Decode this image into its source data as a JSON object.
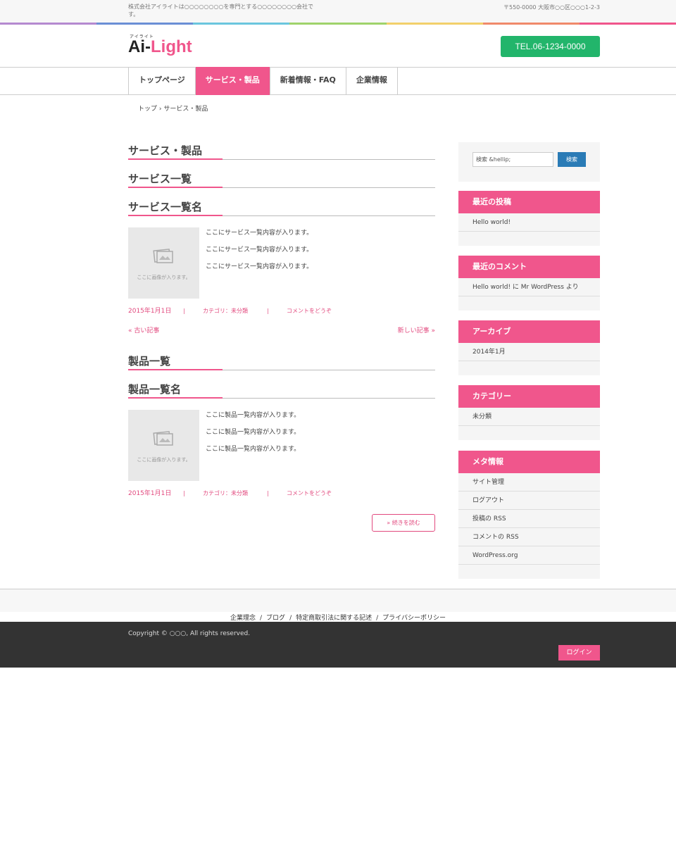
{
  "topbar": {
    "description": "株式会社アイライトは○○○○○○○○を専門とする○○○○○○○○会社です。",
    "address": "〒550-0000 大阪市○○区○○○1-2-3"
  },
  "colors": {
    "accent": "#f0568c",
    "tel_bg": "#22b56b",
    "search_button": "#2a7bb6",
    "footer_bg": "#333333",
    "rainbow": [
      "#b58ad0",
      "#6b8fd6",
      "#6bc6de",
      "#9fd36b",
      "#f2d06b",
      "#f08a6b",
      "#f0568c"
    ]
  },
  "header": {
    "logo_ruby": "アイライト",
    "logo_part1": "Ai-",
    "logo_part2": "Light",
    "tel": "TEL.06-1234-0000"
  },
  "nav": {
    "items": [
      "トップページ",
      "サービス・製品",
      "新着情報・FAQ",
      "企業情報"
    ],
    "active": "サービス・製品"
  },
  "breadcrumb": "トップ › サービス・製品",
  "main": {
    "page_title": "サービス・製品",
    "section1_title": "サービス一覧",
    "post1_title": "サービス一覧名",
    "post1_lines": [
      "ここにサービス一覧内容が入ります。",
      "ここにサービス一覧内容が入ります。",
      "ここにサービス一覧内容が入ります。"
    ],
    "thumb_caption": "ここに画像が入ります。",
    "post1_date": "2015年1月1日",
    "post1_category": "カテゴリ：未分類",
    "post1_comment": "コメントをどうぞ",
    "meta_separator": "|",
    "pager_older": "« 古い記事",
    "pager_newer": "新しい記事 »",
    "section2_title": "製品一覧",
    "post2_title": "製品一覧名",
    "post2_lines": [
      "ここに製品一覧内容が入ります。",
      "ここに製品一覧内容が入ります。",
      "ここに製品一覧内容が入ります。"
    ],
    "post2_date": "2015年1月1日",
    "post2_category": "カテゴリ：未分類",
    "post2_comment": "コメントをどうぞ",
    "read_more": "» 続きを読む"
  },
  "sidebar": {
    "search_placeholder": "検索 &hellip;",
    "search_button": "検索",
    "recent_posts": {
      "title": "最近の投稿",
      "items": [
        "Hello world!"
      ]
    },
    "recent_comments": {
      "title": "最近のコメント",
      "items": [
        "Hello world! に Mr WordPress より"
      ]
    },
    "archives": {
      "title": "アーカイブ",
      "items": [
        "2014年1月"
      ]
    },
    "categories": {
      "title": "カテゴリー",
      "items": [
        "未分類"
      ]
    },
    "meta": {
      "title": "メタ情報",
      "items": [
        "サイト管理",
        "ログアウト",
        "投稿の RSS",
        "コメントの RSS",
        "WordPress.org"
      ]
    }
  },
  "footer": {
    "links": [
      "企業理念",
      "ブログ",
      "特定商取引法に関する記述",
      "プライバシーポリシー"
    ],
    "separator": "/",
    "copyright": "Copyright © ○○○, All rights reserved.",
    "login": "ログイン"
  }
}
